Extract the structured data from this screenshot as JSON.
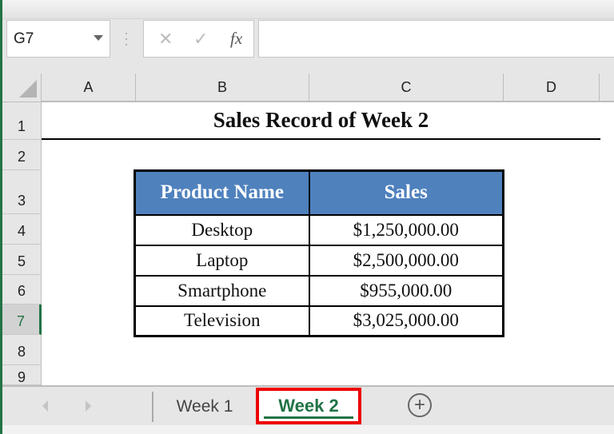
{
  "formula_bar": {
    "name_box": "G7",
    "cancel_icon": "✕",
    "enter_icon": "✓",
    "fx_label": "fx",
    "formula_value": ""
  },
  "columns": [
    "A",
    "B",
    "C",
    "D"
  ],
  "rows": [
    "1",
    "2",
    "3",
    "4",
    "5",
    "6",
    "7",
    "8",
    "9"
  ],
  "selected_row": "7",
  "sheet": {
    "title": "Sales Record of Week 2",
    "table": {
      "headers": [
        "Product Name",
        "Sales"
      ],
      "header_color": "#4f81bd",
      "rows": [
        [
          "Desktop",
          "$1,250,000.00"
        ],
        [
          "Laptop",
          "$2,500,000.00"
        ],
        [
          "Smartphone",
          "$955,000.00"
        ],
        [
          "Television",
          "$3,025,000.00"
        ]
      ]
    }
  },
  "tabs": {
    "items": [
      {
        "label": "Week 1",
        "active": false
      },
      {
        "label": "Week 2",
        "active": true
      }
    ],
    "highlight_color": "#e00000",
    "add_icon": "+"
  }
}
